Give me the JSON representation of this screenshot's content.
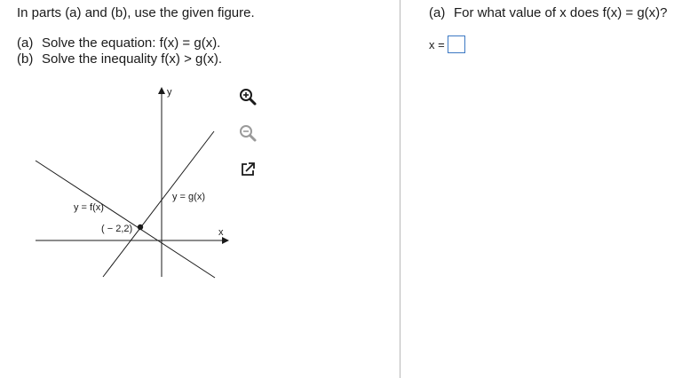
{
  "left": {
    "instruction": "In parts (a) and (b), use the given figure.",
    "parts": [
      {
        "letter": "(a)",
        "text": "Solve the equation: f(x) = g(x)."
      },
      {
        "letter": "(b)",
        "text": "Solve the inequality f(x) > g(x)."
      }
    ],
    "figure": {
      "y_axis_label": "y",
      "x_axis_label": "x",
      "f_label": "y = f(x)",
      "g_label": "y = g(x)",
      "point_label": "( − 2,2)"
    },
    "tools": [
      {
        "name": "zoom-in-button",
        "icon": "zoom-in-icon"
      },
      {
        "name": "zoom-out-button",
        "icon": "zoom-out-icon"
      },
      {
        "name": "popout-button",
        "icon": "popout-icon"
      }
    ]
  },
  "right": {
    "question_letter": "(a)",
    "question_text": "For what value of x does f(x) = g(x)?",
    "answer_label": "x =",
    "answer_value": ""
  },
  "colors": {
    "divider": "#b9b9b9",
    "answer_border": "#3c78c3",
    "text": "#1a1a1a"
  }
}
